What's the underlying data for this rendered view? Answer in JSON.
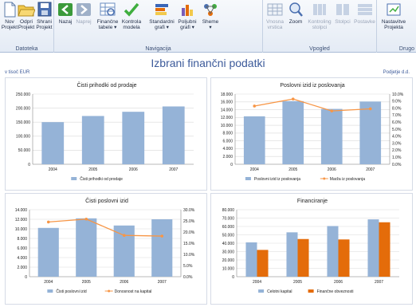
{
  "ribbon": {
    "groups": [
      {
        "label": "Datoteka"
      },
      {
        "label": "Navigacija"
      },
      {
        "label": "Vpogled"
      },
      {
        "label": "Drugo"
      }
    ],
    "buttons": [
      {
        "label": "Nov\nProjekt",
        "icon": "new-file-icon"
      },
      {
        "label": "Odpri\nProjekt",
        "icon": "open-folder-icon"
      },
      {
        "label": "Shrani\nProjekt",
        "icon": "save-icon"
      },
      {
        "label": "Nazaj",
        "icon": "back-arrow-icon"
      },
      {
        "label": "Naprej",
        "icon": "forward-arrow-icon"
      },
      {
        "label": "Finančne\ntabele ▾",
        "icon": "financial-tables-icon"
      },
      {
        "label": "Kontrola\nmodela",
        "icon": "checkmark-icon"
      },
      {
        "label": "Standardni\ngrafi ▾",
        "icon": "standard-charts-icon"
      },
      {
        "label": "Poljubni\ngrafi ▾",
        "icon": "custom-charts-icon"
      },
      {
        "label": "Sheme\n▾",
        "icon": "schemes-icon"
      },
      {
        "label": "Vnosna\nvrstica",
        "icon": "input-row-icon"
      },
      {
        "label": "Zoom",
        "icon": "zoom-icon"
      },
      {
        "label": "Kontroling\nstolpci",
        "icon": "controlling-columns-icon"
      },
      {
        "label": "Stolpci",
        "icon": "columns-icon"
      },
      {
        "label": "Postavke",
        "icon": "items-icon"
      },
      {
        "label": "Nastavitve\nProjekta",
        "icon": "project-settings-icon"
      }
    ]
  },
  "report": {
    "title": "Izbrani finančni podatki",
    "unit_left": "v tisoč EUR",
    "unit_right": "Podjetje d.d."
  },
  "colors": {
    "bar_blue": "#95b3d7",
    "bar_orange": "#e46c0a",
    "line_orange": "#f79646",
    "title_blue": "#3c5a9a"
  },
  "chart_data": [
    {
      "type": "bar",
      "title": "Čisti prihodki od prodaje",
      "categories": [
        "2004",
        "2005",
        "2006",
        "2007"
      ],
      "series": [
        {
          "name": "Čisti prihodki od prodaje",
          "values": [
            150000,
            172000,
            187000,
            206000
          ]
        }
      ],
      "ylim": [
        0,
        250000
      ],
      "yticks": [
        "0",
        "50.000",
        "100.000",
        "150.000",
        "200.000",
        "250.000"
      ],
      "legend": "bottom"
    },
    {
      "type": "bar+line",
      "title": "Poslovni izid iz poslovanja",
      "categories": [
        "2004",
        "2005",
        "2006",
        "2007"
      ],
      "series": [
        {
          "name": "Poslovni izid iz poslovanja",
          "type": "bar",
          "axis": "left",
          "values": [
            12300,
            16200,
            14200,
            16100
          ]
        },
        {
          "name": "Marža iz poslovanja",
          "type": "line",
          "axis": "right",
          "values": [
            8.3,
            9.3,
            7.6,
            7.9
          ]
        }
      ],
      "ylim": [
        0,
        18000
      ],
      "yticks": [
        "0",
        "2.000",
        "4.000",
        "6.000",
        "8.000",
        "10.000",
        "12.000",
        "14.000",
        "16.000",
        "18.000"
      ],
      "y2lim": [
        0,
        10
      ],
      "y2ticks": [
        "0.0%",
        "1.0%",
        "2.0%",
        "3.0%",
        "4.0%",
        "5.0%",
        "6.0%",
        "7.0%",
        "8.0%",
        "9.0%",
        "10.0%"
      ],
      "legend": "bottom"
    },
    {
      "type": "bar+line",
      "title": "Čisti poslovni izid",
      "categories": [
        "2004",
        "2005",
        "2006",
        "2007"
      ],
      "series": [
        {
          "name": "Čisti poslovni izid",
          "type": "bar",
          "axis": "left",
          "values": [
            10200,
            12200,
            10700,
            12000
          ]
        },
        {
          "name": "Donosnost na kapital",
          "type": "line",
          "axis": "right",
          "values": [
            24.5,
            25.8,
            18.5,
            18.2
          ]
        }
      ],
      "ylim": [
        0,
        14000
      ],
      "yticks": [
        "0",
        "2.000",
        "4.000",
        "6.000",
        "8.000",
        "10.000",
        "12.000",
        "14.000"
      ],
      "y2lim": [
        0,
        30
      ],
      "y2ticks": [
        "0.0%",
        "5.0%",
        "10.0%",
        "15.0%",
        "20.0%",
        "25.0%",
        "30.0%"
      ],
      "legend": "bottom"
    },
    {
      "type": "bar",
      "title": "Financiranje",
      "categories": [
        "2004",
        "2005",
        "2006",
        "2007"
      ],
      "series": [
        {
          "name": "Celotni kapital",
          "values": [
            41000,
            53000,
            60500,
            68500
          ]
        },
        {
          "name": "Finančne obveznosti",
          "values": [
            32000,
            45000,
            44500,
            65000
          ]
        }
      ],
      "ylim": [
        0,
        80000
      ],
      "yticks": [
        "0",
        "10.000",
        "20.000",
        "30.000",
        "40.000",
        "50.000",
        "60.000",
        "70.000",
        "80.000"
      ],
      "legend": "bottom"
    }
  ]
}
